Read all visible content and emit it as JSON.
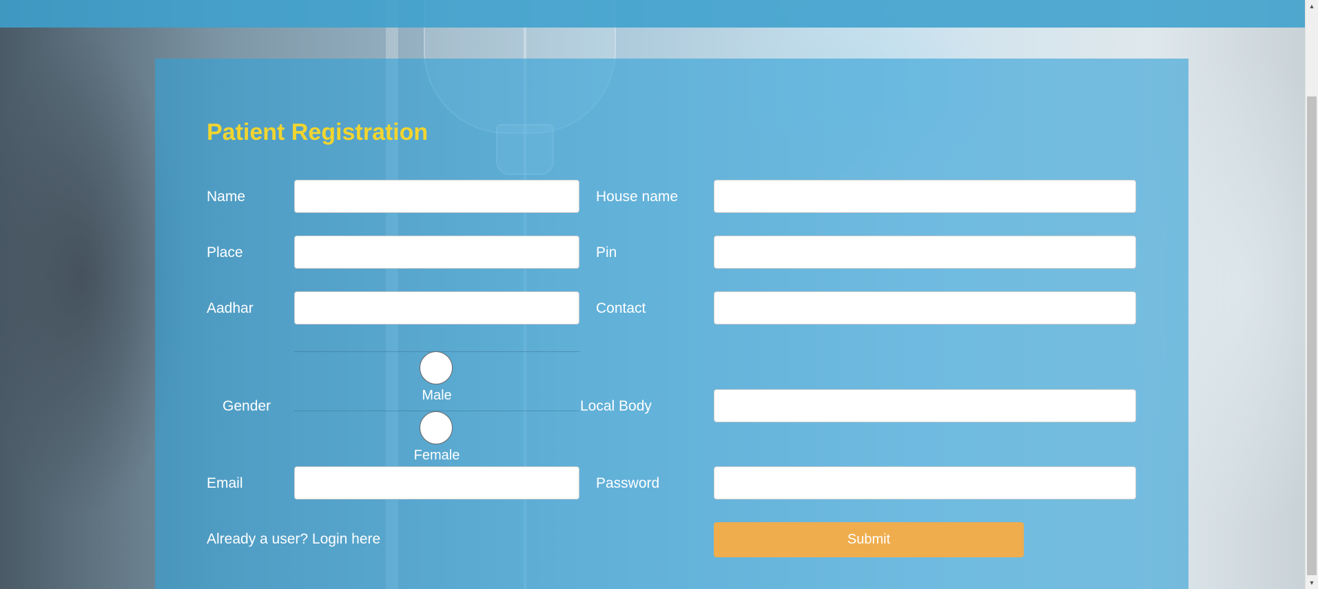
{
  "form": {
    "title": "Patient Registration",
    "labels": {
      "name": "Name",
      "house_name": "House name",
      "place": "Place",
      "pin": "Pin",
      "aadhar": "Aadhar",
      "contact": "Contact",
      "gender": "Gender",
      "local_body": "Local Body",
      "email": "Email",
      "password": "Password"
    },
    "gender_options": [
      "Male",
      "Female"
    ],
    "values": {
      "name": "",
      "house_name": "",
      "place": "",
      "pin": "",
      "aadhar": "",
      "contact": "",
      "local_body": "",
      "email": "",
      "password": ""
    },
    "login_link": "Already a user? Login here",
    "submit_label": "Submit"
  },
  "colors": {
    "title": "#f2d530",
    "panel": "#34a2d7",
    "submit": "#efad4e",
    "topbar": "#3ea0cd"
  },
  "icons": {
    "scroll_up": "triangle-up-icon",
    "scroll_down": "triangle-down-icon"
  }
}
